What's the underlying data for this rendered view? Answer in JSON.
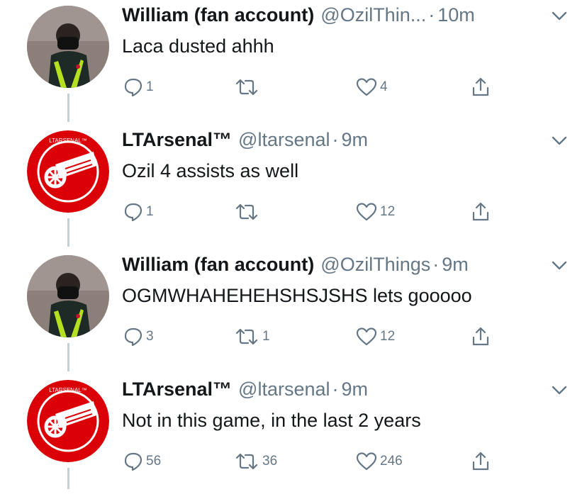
{
  "colors": {
    "text": "#14171a",
    "muted": "#657786",
    "thread_line": "#c4cfd6",
    "arsenal_red": "#db0007"
  },
  "tweets": [
    {
      "name": "William (fan account)",
      "handle": "@OzilThin...",
      "dot": "·",
      "time": "10m",
      "text": "Laca dusted ahhh",
      "avatar": "player-photo",
      "replies": "1",
      "retweets": "",
      "likes": "4"
    },
    {
      "name": "LTArsenal™",
      "handle": "@ltarsenal",
      "dot": "·",
      "time": "9m",
      "text": "Ozil 4 assists as well",
      "avatar": "arsenal-cannon-logo",
      "replies": "1",
      "retweets": "",
      "likes": "12"
    },
    {
      "name": "William (fan account)",
      "handle": "@OzilThings",
      "dot": "·",
      "time": "9m",
      "text": "OGMWHAHEHEHSHSJSHS lets gooooo",
      "avatar": "player-photo",
      "replies": "3",
      "retweets": "1",
      "likes": "12"
    },
    {
      "name": "LTArsenal™",
      "handle": "@ltarsenal",
      "dot": "·",
      "time": "9m",
      "text": "Not in this game, in the last 2 years",
      "avatar": "arsenal-cannon-logo",
      "replies": "56",
      "retweets": "36",
      "likes": "246"
    }
  ],
  "logo_text": "LTARSENAL™"
}
